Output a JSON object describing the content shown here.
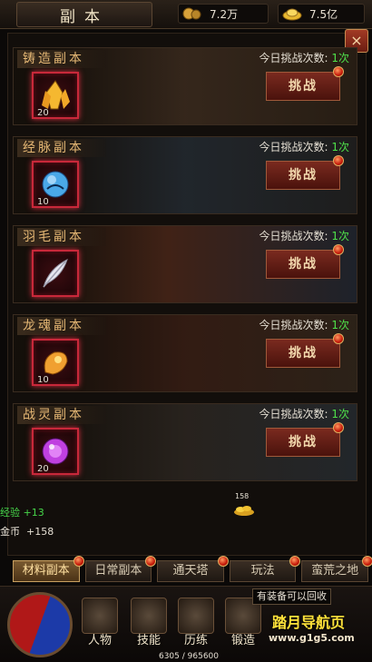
{
  "header": {
    "title": "副本",
    "silver": "7.2万",
    "gold": "7.5亿"
  },
  "close_label": "×",
  "dungeons": [
    {
      "name": "铸造副本",
      "level": "20",
      "count_label": "今日挑战次数:",
      "count_value": "1次",
      "button": "挑战",
      "item_icon": "gold-crystal-icon",
      "item_color": "#f5b830"
    },
    {
      "name": "经脉副本",
      "level": "10",
      "count_label": "今日挑战次数:",
      "count_value": "1次",
      "button": "挑战",
      "item_icon": "blue-orb-icon",
      "item_color": "#4aa8e8"
    },
    {
      "name": "羽毛副本",
      "level": "",
      "count_label": "今日挑战次数:",
      "count_value": "1次",
      "button": "挑战",
      "item_icon": "feather-icon",
      "item_color": "#e8e8f0"
    },
    {
      "name": "龙魂副本",
      "level": "10",
      "count_label": "今日挑战次数:",
      "count_value": "1次",
      "button": "挑战",
      "item_icon": "dragon-soul-icon",
      "item_color": "#f0a030"
    },
    {
      "name": "战灵副本",
      "level": "20",
      "count_label": "今日挑战次数:",
      "count_value": "1次",
      "button": "挑战",
      "item_icon": "purple-orb-icon",
      "item_color": "#c040e0"
    }
  ],
  "gains": {
    "exp": "经验 +13",
    "gold_label": "金币",
    "gold_value": "+158",
    "drop_count": "158"
  },
  "tabs": [
    {
      "label": "材料副本",
      "active": true
    },
    {
      "label": "日常副本",
      "active": false
    },
    {
      "label": "通天塔",
      "active": false
    },
    {
      "label": "玩法",
      "active": false
    },
    {
      "label": "蛮荒之地",
      "active": false
    }
  ],
  "hud": {
    "buttons": [
      {
        "label": "人物",
        "icon": "helmet-icon"
      },
      {
        "label": "技能",
        "icon": "skill-book-icon"
      },
      {
        "label": "历练",
        "icon": "armor-icon"
      },
      {
        "label": "锻造",
        "icon": "anvil-icon"
      }
    ],
    "tooltip": "有装备可以回收",
    "exp_text": "6305 / 965600"
  },
  "watermark": {
    "line1": "踏月导航页",
    "line2": "www.g1g5.com"
  },
  "colors": {
    "accent_red": "#c8283a",
    "count_green": "#4fe04a",
    "name_gold": "#e5b774"
  }
}
